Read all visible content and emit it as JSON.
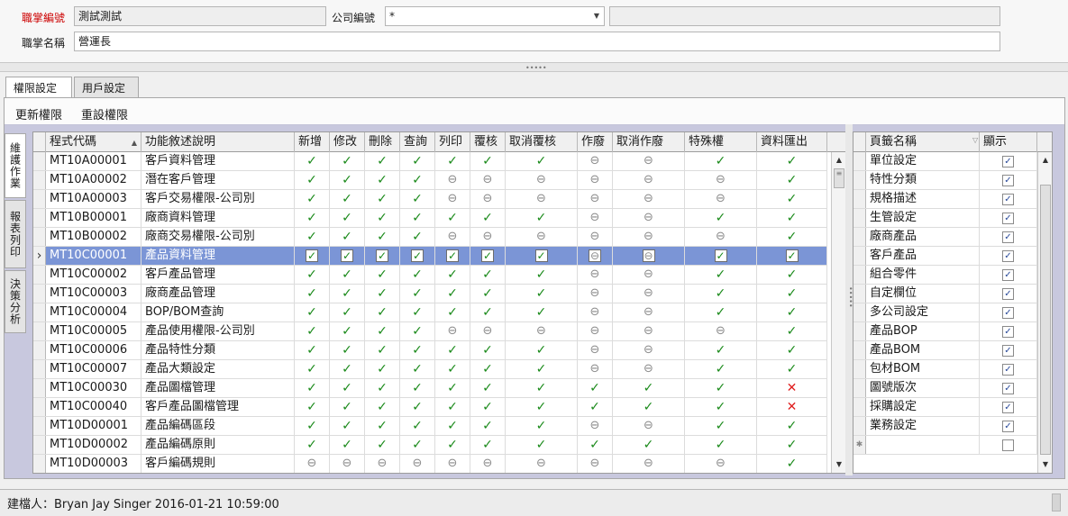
{
  "form": {
    "role_code_label": "職掌編號",
    "role_code_value": "測試測試",
    "company_label": "公司編號",
    "company_value": "*",
    "role_name_label": "職掌名稱",
    "role_name_value": "營運長"
  },
  "tabs": [
    "權限設定",
    "用戶設定"
  ],
  "toolbar": {
    "update": "更新權限",
    "reset": "重設權限"
  },
  "side_tabs": [
    "維護作業",
    "報表列印",
    "決策分析"
  ],
  "perm_grid": {
    "columns": [
      "程式代碼",
      "功能敘述說明",
      "新增",
      "修改",
      "刪除",
      "查詢",
      "列印",
      "覆核",
      "取消覆核",
      "作廢",
      "取消作廢",
      "特殊權",
      "資料匯出"
    ],
    "selected_row": 5,
    "rows": [
      {
        "code": "MT10A00001",
        "desc": "客戶資料管理",
        "flags": [
          "y",
          "y",
          "y",
          "y",
          "y",
          "y",
          "y",
          "n",
          "n",
          "y",
          "y"
        ]
      },
      {
        "code": "MT10A00002",
        "desc": "潛在客戶管理",
        "flags": [
          "y",
          "y",
          "y",
          "y",
          "n",
          "n",
          "n",
          "n",
          "n",
          "n",
          "y"
        ]
      },
      {
        "code": "MT10A00003",
        "desc": "客戶交易權限-公司別",
        "flags": [
          "y",
          "y",
          "y",
          "y",
          "n",
          "n",
          "n",
          "n",
          "n",
          "n",
          "y"
        ]
      },
      {
        "code": "MT10B00001",
        "desc": "廠商資料管理",
        "flags": [
          "y",
          "y",
          "y",
          "y",
          "y",
          "y",
          "y",
          "n",
          "n",
          "y",
          "y"
        ]
      },
      {
        "code": "MT10B00002",
        "desc": "廠商交易權限-公司別",
        "flags": [
          "y",
          "y",
          "y",
          "y",
          "n",
          "n",
          "n",
          "n",
          "n",
          "n",
          "y"
        ]
      },
      {
        "code": "MT10C00001",
        "desc": "產品資料管理",
        "flags": [
          "y",
          "y",
          "y",
          "y",
          "y",
          "y",
          "y",
          "n",
          "n",
          "y",
          "y"
        ]
      },
      {
        "code": "MT10C00002",
        "desc": "客戶產品管理",
        "flags": [
          "y",
          "y",
          "y",
          "y",
          "y",
          "y",
          "y",
          "n",
          "n",
          "y",
          "y"
        ]
      },
      {
        "code": "MT10C00003",
        "desc": "廠商產品管理",
        "flags": [
          "y",
          "y",
          "y",
          "y",
          "y",
          "y",
          "y",
          "n",
          "n",
          "y",
          "y"
        ]
      },
      {
        "code": "MT10C00004",
        "desc": "BOP/BOM查詢",
        "flags": [
          "y",
          "y",
          "y",
          "y",
          "y",
          "y",
          "y",
          "n",
          "n",
          "y",
          "y"
        ]
      },
      {
        "code": "MT10C00005",
        "desc": "產品使用權限-公司別",
        "flags": [
          "y",
          "y",
          "y",
          "y",
          "n",
          "n",
          "n",
          "n",
          "n",
          "n",
          "y"
        ]
      },
      {
        "code": "MT10C00006",
        "desc": "產品特性分類",
        "flags": [
          "y",
          "y",
          "y",
          "y",
          "y",
          "y",
          "y",
          "n",
          "n",
          "y",
          "y"
        ]
      },
      {
        "code": "MT10C00007",
        "desc": "產品大類設定",
        "flags": [
          "y",
          "y",
          "y",
          "y",
          "y",
          "y",
          "y",
          "n",
          "n",
          "y",
          "y"
        ]
      },
      {
        "code": "MT10C00030",
        "desc": "產品圖檔管理",
        "flags": [
          "y",
          "y",
          "y",
          "y",
          "y",
          "y",
          "y",
          "y",
          "y",
          "y",
          "x"
        ]
      },
      {
        "code": "MT10C00040",
        "desc": "客戶產品圖檔管理",
        "flags": [
          "y",
          "y",
          "y",
          "y",
          "y",
          "y",
          "y",
          "y",
          "y",
          "y",
          "x"
        ]
      },
      {
        "code": "MT10D00001",
        "desc": "產品編碼區段",
        "flags": [
          "y",
          "y",
          "y",
          "y",
          "y",
          "y",
          "y",
          "n",
          "n",
          "y",
          "y"
        ]
      },
      {
        "code": "MT10D00002",
        "desc": "產品編碼原則",
        "flags": [
          "y",
          "y",
          "y",
          "y",
          "y",
          "y",
          "y",
          "y",
          "y",
          "y",
          "y"
        ]
      },
      {
        "code": "MT10D00003",
        "desc": "客戶編碼規則",
        "flags": [
          "n",
          "n",
          "n",
          "n",
          "n",
          "n",
          "n",
          "n",
          "n",
          "n",
          "y"
        ]
      }
    ]
  },
  "page_grid": {
    "columns": [
      "頁籤名稱",
      "顯示"
    ],
    "rows": [
      "單位設定",
      "特性分類",
      "規格描述",
      "生管設定",
      "廠商產品",
      "客戶產品",
      "組合零件",
      "自定欄位",
      "多公司設定",
      "產品BOP",
      "產品BOM",
      "包材BOM",
      "圖號版次",
      "採購設定",
      "業務設定"
    ]
  },
  "icons": {
    "allowed": "check-icon",
    "not_applicable": "disabled-icon",
    "denied": "cross-icon"
  },
  "colors": {
    "selected_row": "#7b95d6",
    "panel_bg": "#c8c8de",
    "check": "#1a8a1a",
    "cross": "#e02020",
    "required_label": "#cc0000"
  },
  "status": {
    "text": "建檔人：Bryan Jay Singer 2016-01-21 10:59:00"
  }
}
